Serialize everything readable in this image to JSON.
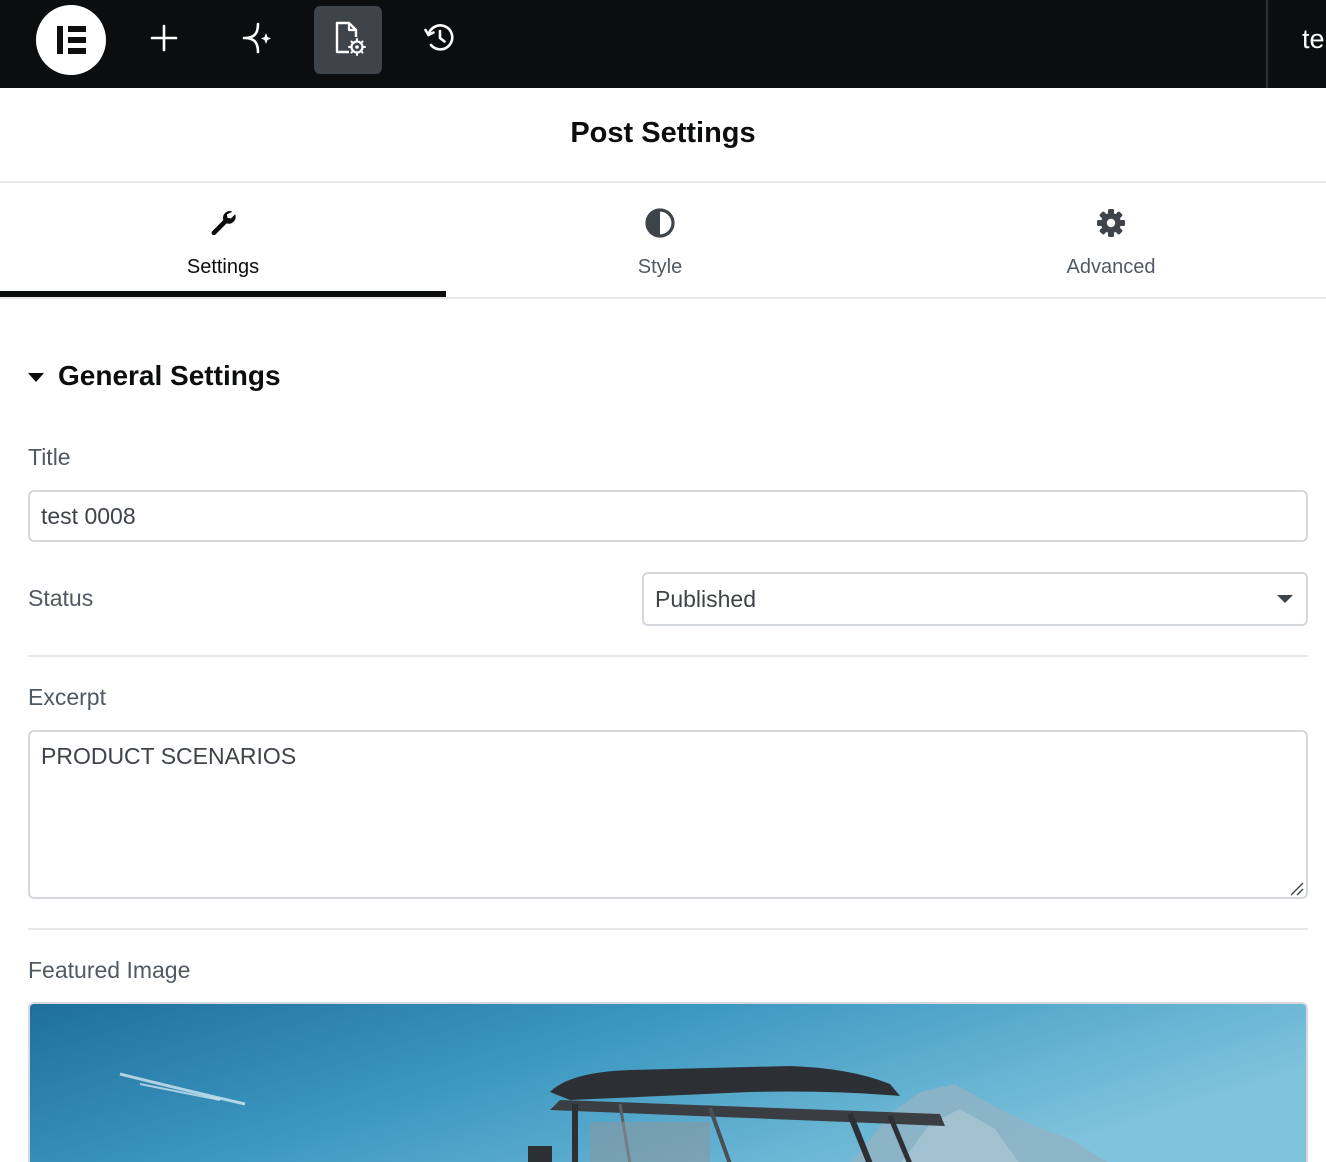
{
  "topbar": {
    "logo_icon": "elementor-logo-icon",
    "buttons": [
      {
        "icon": "plus-icon"
      },
      {
        "icon": "sparkle-ai-icon"
      },
      {
        "icon": "page-settings-icon",
        "active": true
      },
      {
        "icon": "history-icon"
      }
    ],
    "document_title": "te"
  },
  "panel": {
    "title": "Post Settings",
    "tabs": [
      {
        "label": "Settings",
        "icon": "wrench-icon",
        "active": true
      },
      {
        "label": "Style",
        "icon": "half-circle-icon",
        "active": false
      },
      {
        "label": "Advanced",
        "icon": "gear-icon",
        "active": false
      }
    ]
  },
  "section": {
    "title": "General Settings",
    "expanded": true
  },
  "fields": {
    "title_label": "Title",
    "title_value": "test 0008",
    "status_label": "Status",
    "status_value": "Published",
    "excerpt_label": "Excerpt",
    "excerpt_value": "PRODUCT SCENARIOS",
    "featured_label": "Featured Image"
  },
  "colors": {
    "topbar_bg": "#0c0d0e",
    "active_button_bg": "#3f444b",
    "border": "#d5d8dc",
    "divider": "#e6e8ea",
    "label_text": "#515962"
  }
}
